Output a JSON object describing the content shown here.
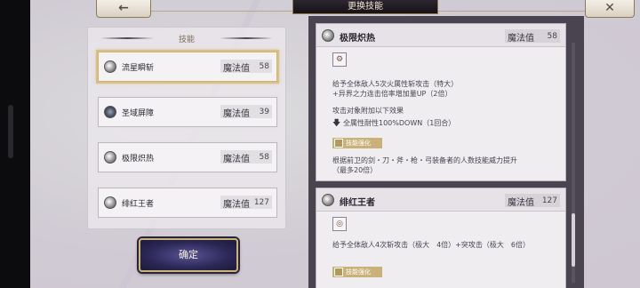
{
  "header": {
    "title": "更换技能",
    "back_icon": "←",
    "close_icon": "✕"
  },
  "skill_list": {
    "title": "技能",
    "mp_label": "魔法值",
    "items": [
      {
        "name": "流星瞬斩",
        "mp": "58",
        "icon": "skill-orb-icon",
        "selected": true
      },
      {
        "name": "圣域屏障",
        "mp": "39",
        "icon": "shield-icon",
        "selected": false
      },
      {
        "name": "极限炽热",
        "mp": "58",
        "icon": "skill-orb-icon",
        "selected": false
      },
      {
        "name": "绯红王者",
        "mp": "127",
        "icon": "skill-orb-icon",
        "selected": false
      }
    ]
  },
  "confirm": {
    "label": "确定"
  },
  "details": [
    {
      "name": "极限炽热",
      "mp_label": "魔法值",
      "mp": "58",
      "attr_icon": "⚙",
      "desc_lines": [
        "给予全体敌人5次火属性斩攻击（特大）",
        "+异界之力连击倍率增加量UP（2倍）"
      ],
      "effect_title": "攻击对象附加以下效果",
      "effect_line": "全属性耐性100%DOWN（1回合）",
      "tag": "技能强化",
      "enhance_lines": [
        "根据前卫的剑・刀・斧・枪・弓装备者的人数技能威力提升",
        "（最多20倍）"
      ]
    },
    {
      "name": "绯红王者",
      "mp_label": "魔法值",
      "mp": "127",
      "attr_icon": "◎",
      "desc_lines": [
        "给予全体敌人4次斩攻击（极大　4倍）+突攻击（极大　6倍）"
      ],
      "tag": "技能强化"
    }
  ],
  "colors": {
    "gold": "#c9b37a",
    "confirm_bg": "#2b2756",
    "panel_dark": "#4a4450"
  }
}
